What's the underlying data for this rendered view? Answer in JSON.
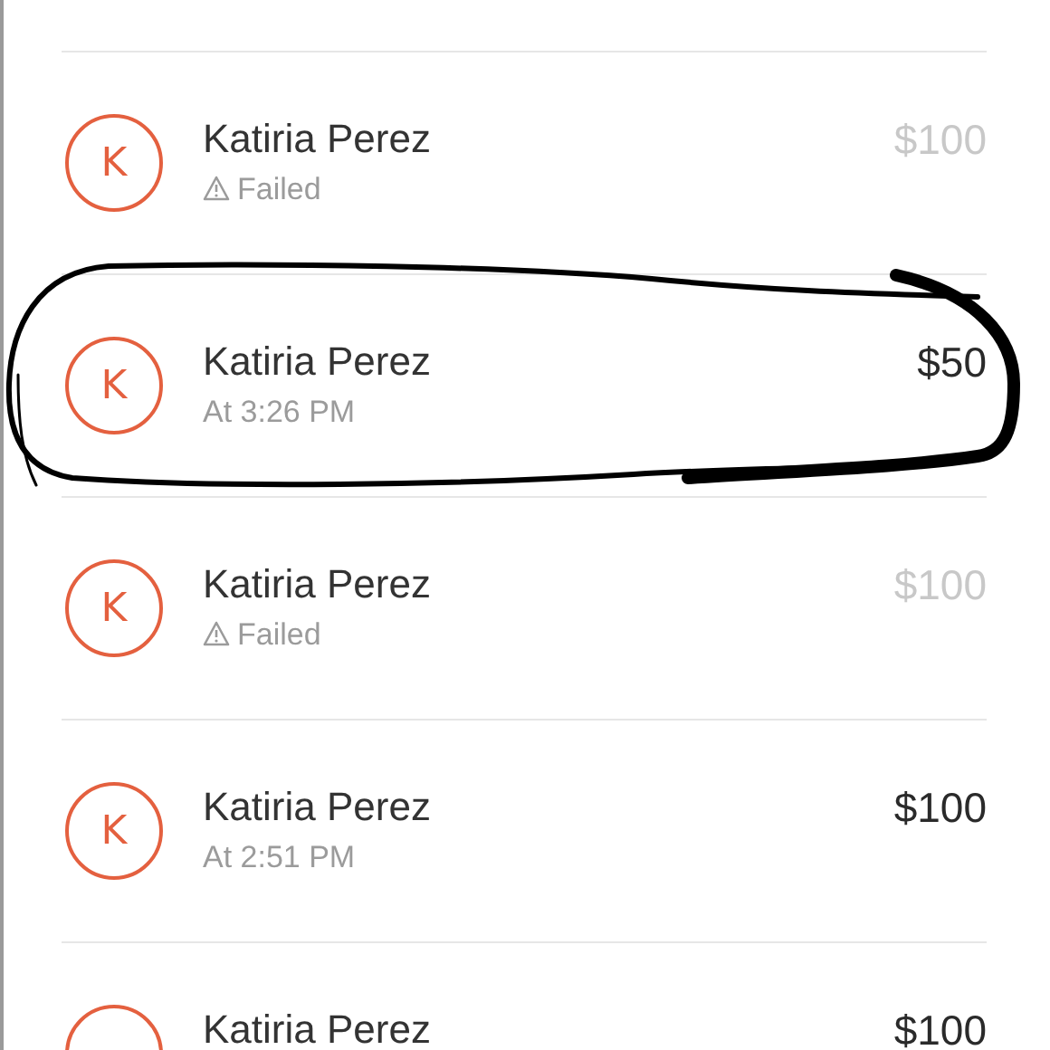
{
  "transactions": [
    {
      "initial": "K",
      "name": "Katiria Perez",
      "failed": true,
      "detail": "Failed",
      "amount": "$100",
      "annotated": false
    },
    {
      "initial": "K",
      "name": "Katiria Perez",
      "failed": false,
      "detail": "At 3:26 PM",
      "amount": "$50",
      "annotated": true
    },
    {
      "initial": "K",
      "name": "Katiria Perez",
      "failed": true,
      "detail": "Failed",
      "amount": "$100",
      "annotated": false
    },
    {
      "initial": "K",
      "name": "Katiria Perez",
      "failed": false,
      "detail": "At 2:51 PM",
      "amount": "$100",
      "annotated": false
    },
    {
      "name": "Katiria Perez",
      "failed": false,
      "amount": "$100",
      "annotated": false
    }
  ]
}
